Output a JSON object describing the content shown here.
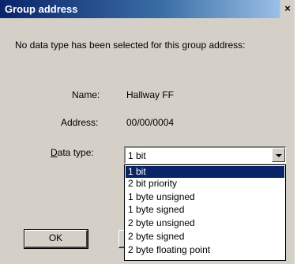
{
  "dialog": {
    "title": "Group address",
    "close_glyph": "×",
    "message": "No data type has been selected for this group address:",
    "name_label": "Name:",
    "name_value": "Hallway FF",
    "address_label": "Address:",
    "address_value": "00/00/0004",
    "datatype_label_underlined": "D",
    "datatype_label_rest": "ata type:",
    "datatype_selected": "1 bit",
    "datatype_options": [
      "1 bit",
      "2 bit priority",
      "1 byte unsigned",
      "1 byte signed",
      "2 byte unsigned",
      "2 byte signed",
      "2 byte floating point"
    ],
    "ok_label": "OK"
  },
  "colors": {
    "face": "#d4d0c8",
    "title_start": "#0a246a",
    "title_end": "#a6caf0",
    "selection": "#0a246a"
  }
}
